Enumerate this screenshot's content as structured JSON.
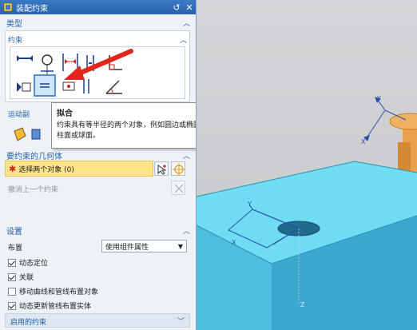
{
  "dialog": {
    "title": "装配约束",
    "reset_glyph": "↺",
    "close_glyph": "✕"
  },
  "type_section": {
    "label": "类型"
  },
  "constraint_section": {
    "label": "约束"
  },
  "motion_section": {
    "label": "运动副"
  },
  "tooltip": {
    "title": "拟合",
    "body": "约束具有等半径的两个对象，例如圆边或椭圆边，或者圆柱面或球面。"
  },
  "geometry_section": {
    "label": "要约束的几何体",
    "select_label": "选择两个对象 (0)",
    "undo_label": "撤消上一个约束"
  },
  "settings_section": {
    "label": "设置",
    "layout_label": "布置",
    "layout_value": "使用组件属性",
    "options": [
      {
        "label": "动态定位",
        "checked": true
      },
      {
        "label": "关联",
        "checked": true
      },
      {
        "label": "移动曲线和管线布置对象",
        "checked": false
      },
      {
        "label": "动态更新管线布置实体",
        "checked": true
      }
    ],
    "enabled_label": "启用的约束"
  },
  "viewport": {
    "axis_labels": [
      "Y",
      "X",
      "Y",
      "X",
      "Z"
    ],
    "colors": {
      "part": "#5fd4ee",
      "cylinder": "#e8a24c",
      "background": "#c8cacd",
      "arrow": "#e1261c"
    }
  }
}
